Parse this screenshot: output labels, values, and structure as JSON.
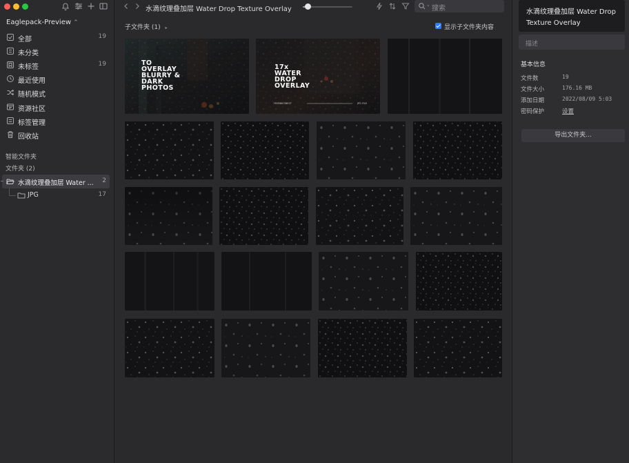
{
  "sidebar": {
    "library_name": "Eaglepack-Preview",
    "nav_items": [
      {
        "label": "全部",
        "count": "19",
        "icon": "all-items-icon"
      },
      {
        "label": "未分类",
        "count": "",
        "icon": "unfiled-icon"
      },
      {
        "label": "未标签",
        "count": "19",
        "icon": "untagged-icon"
      },
      {
        "label": "最近使用",
        "count": "",
        "icon": "recent-clock-icon"
      },
      {
        "label": "随机模式",
        "count": "",
        "icon": "shuffle-icon"
      },
      {
        "label": "资源社区",
        "count": "",
        "icon": "community-icon"
      },
      {
        "label": "标签管理",
        "count": "",
        "icon": "tag-manager-icon"
      },
      {
        "label": "回收站",
        "count": "",
        "icon": "trash-icon"
      }
    ],
    "smart_folders_label": "智能文件夹",
    "folders_label": "文件夹 (2)",
    "folders": [
      {
        "label": "水滴纹理叠加层 Water ...",
        "count": "2",
        "icon": "folder-open-icon"
      },
      {
        "label": "JPG",
        "count": "17",
        "icon": "folder-icon"
      }
    ]
  },
  "toolbar": {
    "title": "水滴纹理叠加层 Water Drop Texture Overlay",
    "zoom_level": 0.1,
    "search_placeholder": "搜索"
  },
  "content": {
    "subfolder_label": "子文件夹 (1)",
    "show_subfolder_label": "显示子文件夹内容",
    "show_subfolder_checked": true,
    "covers": [
      {
        "lines": [
          "TO",
          "OVERLAY",
          "BLURRY &",
          "DARK",
          "PHOTOS"
        ]
      },
      {
        "lines": [
          "17x",
          "WATER",
          "DROP",
          "OVERLAY"
        ],
        "footer_left": "FREEBIESBEST",
        "footer_right": "JPG FILE"
      }
    ]
  },
  "inspector": {
    "title": "水滴纹理叠加层 Water Drop Texture Overlay",
    "description_placeholder": "描述",
    "basic_info_label": "基本信息",
    "info": [
      {
        "key": "文件数",
        "value": "19"
      },
      {
        "key": "文件大小",
        "value": "176.16 MB"
      },
      {
        "key": "添加日期",
        "value": "2022/08/09 5:03"
      },
      {
        "key": "密码保护",
        "value": "设置"
      }
    ],
    "export_label": "导出文件夹..."
  },
  "colors": {
    "accent": "#2f7cf6",
    "traffic_red": "#ff5f57",
    "traffic_yellow": "#febc2e",
    "traffic_green": "#28c840"
  }
}
